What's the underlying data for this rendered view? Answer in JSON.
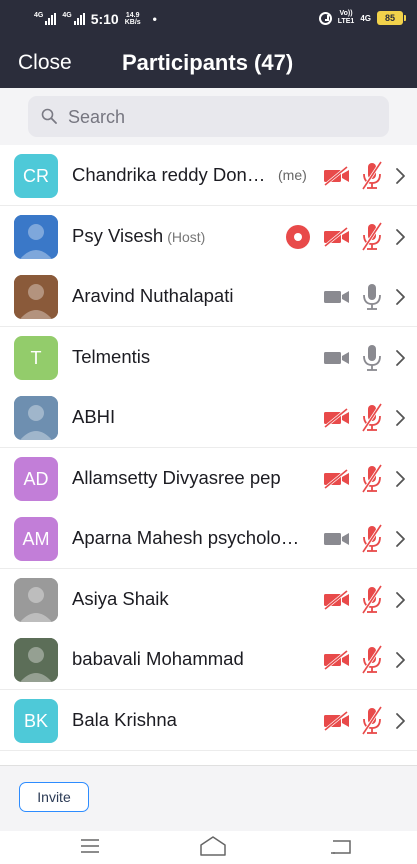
{
  "status_bar": {
    "signal1_label": "4G",
    "signal2_label": "4G",
    "time": "5:10",
    "speed_value": "14.9",
    "speed_unit": "KB/s",
    "dot": "•",
    "volte_top": "Vo))",
    "volte_bottom": "LTE1",
    "net_right": "4G",
    "battery": "85"
  },
  "header": {
    "close_label": "Close",
    "title": "Participants (47)"
  },
  "search": {
    "placeholder": "Search"
  },
  "participants": [
    {
      "initials": "CR",
      "avatar_color": "#4ec9d8",
      "name": "Chandrika reddy Don…",
      "badge": "",
      "me_label": "(me)",
      "recording": false,
      "video": "off",
      "audio": "muted"
    },
    {
      "initials": "",
      "avatar_color": "#3a78c8",
      "name": "Psy Visesh",
      "badge": "(Host)",
      "me_label": "",
      "recording": true,
      "video": "off",
      "audio": "muted"
    },
    {
      "initials": "",
      "avatar_color": "#8a5a3a",
      "name": "Aravind Nuthalapati",
      "badge": "",
      "me_label": "",
      "recording": false,
      "video": "on",
      "audio": "on"
    },
    {
      "initials": "T",
      "avatar_color": "#93cc6b",
      "name": "Telmentis",
      "badge": "",
      "me_label": "",
      "recording": false,
      "video": "on",
      "audio": "on"
    },
    {
      "initials": "",
      "avatar_color": "#6e8fb0",
      "name": "ABHI",
      "badge": "",
      "me_label": "",
      "recording": false,
      "video": "off",
      "audio": "muted"
    },
    {
      "initials": "AD",
      "avatar_color": "#c27ed8",
      "name": "Allamsetty Divyasree pep",
      "badge": "",
      "me_label": "",
      "recording": false,
      "video": "off",
      "audio": "muted"
    },
    {
      "initials": "AM",
      "avatar_color": "#c27ed8",
      "name": "Aparna Mahesh psycholo…",
      "badge": "",
      "me_label": "",
      "recording": false,
      "video": "on",
      "audio": "muted"
    },
    {
      "initials": "",
      "avatar_color": "#9a9a9a",
      "name": "Asiya Shaik",
      "badge": "",
      "me_label": "",
      "recording": false,
      "video": "off",
      "audio": "muted"
    },
    {
      "initials": "",
      "avatar_color": "#5c6e58",
      "name": "babavali Mohammad",
      "badge": "",
      "me_label": "",
      "recording": false,
      "video": "off",
      "audio": "muted"
    },
    {
      "initials": "BK",
      "avatar_color": "#4ec9d8",
      "name": "Bala Krishna",
      "badge": "",
      "me_label": "",
      "recording": false,
      "video": "off",
      "audio": "muted"
    }
  ],
  "footer": {
    "invite_label": "Invite"
  },
  "colors": {
    "header_bg": "#2b2d3b",
    "muted_red": "#e84a4a",
    "icon_gray": "#8a8a90",
    "accent_blue": "#2d8cff"
  },
  "icons": {
    "search": "search-icon",
    "video_off": "video-off-icon",
    "video_on": "video-icon",
    "mic_muted": "mic-muted-icon",
    "mic_on": "mic-icon",
    "recording": "recording-icon",
    "chevron": "chevron-right-icon"
  }
}
